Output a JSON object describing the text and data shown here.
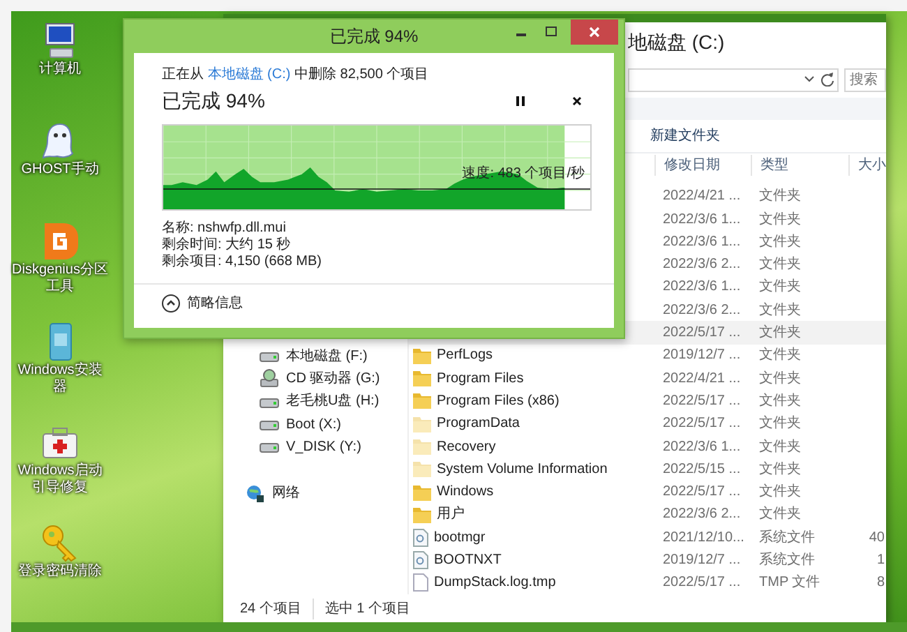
{
  "desktop_icons": [
    {
      "label": "计算机",
      "kind": "computer"
    },
    {
      "label": "GHOST手动",
      "kind": "ghost"
    },
    {
      "label": "Diskgenius分区工具",
      "kind": "disk"
    },
    {
      "label": "Windows安装器",
      "kind": "installer"
    },
    {
      "label": "Windows启动引导修复",
      "kind": "repair"
    },
    {
      "label": "登录密码清除",
      "kind": "key"
    }
  ],
  "explorer": {
    "title": "地磁盘 (C:)",
    "search": {
      "placeholder": "搜索"
    },
    "toolbar": [
      "新建文件夹"
    ],
    "columns": [
      "修改日期",
      "类型",
      "大小"
    ],
    "nav": [
      {
        "label": "本地磁盘 (F:)",
        "kind": "drive"
      },
      {
        "label": "CD 驱动器 (G:)",
        "kind": "cd"
      },
      {
        "label": "老毛桃U盘 (H:)",
        "kind": "drive"
      },
      {
        "label": "Boot (X:)",
        "kind": "drive"
      },
      {
        "label": "V_DISK (Y:)",
        "kind": "drive"
      },
      {
        "label": "网络",
        "kind": "network"
      }
    ],
    "rows": [
      {
        "date": "2022/4/21 ...",
        "type": "文件夹"
      },
      {
        "date": "2022/3/6 1...",
        "type": "文件夹"
      },
      {
        "date": "2022/3/6 1...",
        "type": "文件夹"
      },
      {
        "date": "2022/3/6 2...",
        "type": "文件夹"
      },
      {
        "date": "2022/3/6 1...",
        "type": "文件夹"
      },
      {
        "date": "2022/3/6 2...",
        "type": "文件夹"
      },
      {
        "date": "2022/5/17 ...",
        "type": "文件夹",
        "selected": true
      },
      {
        "name": "PerfLogs",
        "kind": "folder",
        "date": "2019/12/7 ...",
        "type": "文件夹",
        "selected": false
      },
      {
        "name": "Program Files",
        "kind": "folder",
        "date": "2022/4/21 ...",
        "type": "文件夹",
        "selected": false
      },
      {
        "name": "Program Files (x86)",
        "kind": "folder",
        "date": "2022/5/17 ...",
        "type": "文件夹",
        "selected": false
      },
      {
        "name": "ProgramData",
        "kind": "hidden-folder",
        "date": "2022/5/17 ...",
        "type": "文件夹",
        "selected": false
      },
      {
        "name": "Recovery",
        "kind": "hidden-folder",
        "date": "2022/3/6 1...",
        "type": "文件夹",
        "selected": false
      },
      {
        "name": "System Volume Information",
        "kind": "hidden-folder",
        "date": "2022/5/15 ...",
        "type": "文件夹",
        "selected": false
      },
      {
        "name": "Windows",
        "kind": "folder",
        "date": "2022/5/17 ...",
        "type": "文件夹",
        "selected": false
      },
      {
        "name": "用户",
        "kind": "folder",
        "date": "2022/3/6 2...",
        "type": "文件夹",
        "selected": false
      },
      {
        "name": "bootmgr",
        "kind": "system-file",
        "date": "2021/12/10...",
        "type": "系统文件",
        "size": "40",
        "selected": false
      },
      {
        "name": "BOOTNXT",
        "kind": "system-file",
        "date": "2019/12/7 ...",
        "type": "系统文件",
        "size": "1",
        "selected": false
      },
      {
        "name": "DumpStack.log.tmp",
        "kind": "file",
        "date": "2022/5/17 ...",
        "type": "TMP 文件",
        "size": "8",
        "selected": false
      }
    ],
    "status": [
      "24 个项目",
      "选中 1 个项目"
    ]
  },
  "dialog": {
    "title": "已完成 94%",
    "source_prefix": "正在从",
    "source_link": "本地磁盘 (C:)",
    "source_suffix": "中删除 82,500 个项目",
    "heading": "已完成 94%",
    "level": 0.94,
    "speed": "速度: 483 个项目/秒",
    "details": [
      "名称: nshwfp.dll.mui",
      "剩余时间: 大约 15 秒",
      "剩余项目: 4,150 (668 MB)"
    ],
    "toggle": "简略信息"
  }
}
